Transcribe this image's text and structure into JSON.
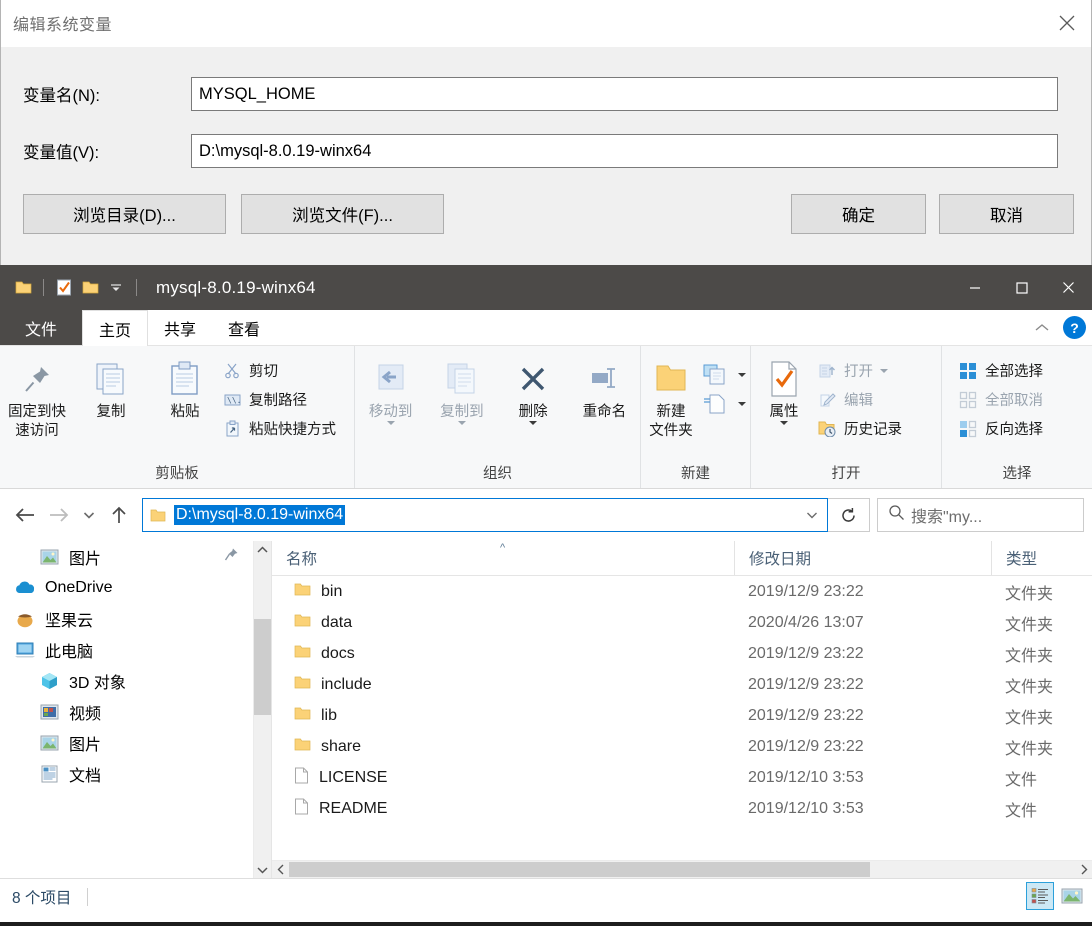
{
  "dialog": {
    "title": "编辑系统变量",
    "close_icon": "close-icon",
    "fields": [
      {
        "label": "变量名(N):",
        "value": "MYSQL_HOME"
      },
      {
        "label": "变量值(V):",
        "value": "D:\\mysql-8.0.19-winx64"
      }
    ],
    "buttons": {
      "browse_dir": "浏览目录(D)...",
      "browse_file": "浏览文件(F)...",
      "ok": "确定",
      "cancel": "取消"
    }
  },
  "explorer": {
    "title": "mysql-8.0.19-winx64",
    "window_controls": {
      "minimize": "—",
      "maximize": "▢",
      "close": "✕"
    },
    "tabs": [
      {
        "label": "文件",
        "kind": "file"
      },
      {
        "label": "主页",
        "kind": "active"
      },
      {
        "label": "共享",
        "kind": "normal"
      },
      {
        "label": "查看",
        "kind": "normal"
      }
    ],
    "help_label": "?",
    "ribbon": {
      "groups": [
        {
          "title": "剪贴板",
          "big": [
            {
              "label": "固定到快\n速访问",
              "line1": "固定到快",
              "line2": "速访问",
              "icon": "pin-icon",
              "dim": false
            },
            {
              "label": "复制",
              "line1": "复制",
              "line2": "",
              "icon": "copy-icon",
              "dim": false
            },
            {
              "label": "粘贴",
              "line1": "粘贴",
              "line2": "",
              "icon": "paste-icon",
              "dim": false
            }
          ],
          "small": [
            {
              "label": "剪切",
              "icon": "scissors-icon",
              "dim": false
            },
            {
              "label": "复制路径",
              "icon": "copy-path-icon",
              "dim": false
            },
            {
              "label": "粘贴快捷方式",
              "icon": "paste-shortcut-icon",
              "dim": false
            }
          ]
        },
        {
          "title": "组织",
          "big": [
            {
              "line1": "移动到",
              "line2": "",
              "icon": "move-to-icon",
              "dim": true,
              "caret": true
            },
            {
              "line1": "复制到",
              "line2": "",
              "icon": "copy-to-icon",
              "dim": true,
              "caret": true
            },
            {
              "line1": "删除",
              "line2": "",
              "icon": "delete-icon",
              "dim": false,
              "caret": true
            },
            {
              "line1": "重命名",
              "line2": "",
              "icon": "rename-icon",
              "dim": false,
              "caret": false
            }
          ],
          "small": []
        },
        {
          "title": "新建",
          "big": [
            {
              "line1": "新建",
              "line2": "文件夹",
              "icon": "new-folder-icon",
              "dim": false,
              "caret": false
            }
          ],
          "small": [
            {
              "label": "",
              "icon": "new-item-icon",
              "dim": false,
              "caret": true
            },
            {
              "label": "",
              "icon": "easy-access-icon",
              "dim": false,
              "caret": true
            }
          ]
        },
        {
          "title": "打开",
          "big": [
            {
              "line1": "属性",
              "line2": "",
              "icon": "properties-icon",
              "dim": false,
              "caret": true
            }
          ],
          "small": [
            {
              "label": "打开",
              "icon": "open-icon",
              "dim": true,
              "caret": true
            },
            {
              "label": "编辑",
              "icon": "edit-icon",
              "dim": true,
              "caret": false
            },
            {
              "label": "历史记录",
              "icon": "history-icon",
              "dim": false,
              "caret": false
            }
          ]
        },
        {
          "title": "选择",
          "big": [],
          "small": [
            {
              "label": "全部选择",
              "icon": "select-all-icon",
              "dim": false
            },
            {
              "label": "全部取消",
              "icon": "select-none-icon",
              "dim": true
            },
            {
              "label": "反向选择",
              "icon": "invert-selection-icon",
              "dim": false
            }
          ]
        }
      ]
    },
    "addressbar": {
      "back_icon": "back-arrow-icon",
      "forward_icon": "forward-arrow-icon",
      "recent_icon": "chevron-down-icon",
      "up_icon": "up-arrow-icon",
      "path": "D:\\mysql-8.0.19-winx64",
      "dropdown_icon": "chevron-down-icon",
      "refresh_icon": "refresh-icon",
      "search_icon": "search-icon",
      "search_placeholder": "搜索\"my..."
    },
    "nav_pane": {
      "items": [
        {
          "label": "图片",
          "icon": "pictures-icon",
          "indent": 1,
          "pinned": true
        },
        {
          "label": "OneDrive",
          "icon": "onedrive-icon",
          "indent": 0,
          "pinned": false
        },
        {
          "label": "坚果云",
          "icon": "nutstore-icon",
          "indent": 0,
          "pinned": false
        },
        {
          "label": "此电脑",
          "icon": "this-pc-icon",
          "indent": 0,
          "pinned": false
        },
        {
          "label": "3D 对象",
          "icon": "3d-objects-icon",
          "indent": 1,
          "pinned": false
        },
        {
          "label": "视频",
          "icon": "videos-icon",
          "indent": 1,
          "pinned": false
        },
        {
          "label": "图片",
          "icon": "pictures-icon",
          "indent": 1,
          "pinned": false
        },
        {
          "label": "文档",
          "icon": "documents-icon",
          "indent": 1,
          "pinned": false
        }
      ]
    },
    "file_list": {
      "columns": [
        "名称",
        "修改日期",
        "类型"
      ],
      "sort_column": "名称",
      "sort_direction": "asc",
      "rows": [
        {
          "name": "bin",
          "date": "2019/12/9 23:22",
          "type": "文件夹",
          "icon": "folder-icon"
        },
        {
          "name": "data",
          "date": "2020/4/26 13:07",
          "type": "文件夹",
          "icon": "folder-icon"
        },
        {
          "name": "docs",
          "date": "2019/12/9 23:22",
          "type": "文件夹",
          "icon": "folder-icon"
        },
        {
          "name": "include",
          "date": "2019/12/9 23:22",
          "type": "文件夹",
          "icon": "folder-icon"
        },
        {
          "name": "lib",
          "date": "2019/12/9 23:22",
          "type": "文件夹",
          "icon": "folder-icon"
        },
        {
          "name": "share",
          "date": "2019/12/9 23:22",
          "type": "文件夹",
          "icon": "folder-icon"
        },
        {
          "name": "LICENSE",
          "date": "2019/12/10 3:53",
          "type": "文件",
          "icon": "file-icon"
        },
        {
          "name": "README",
          "date": "2019/12/10 3:53",
          "type": "文件",
          "icon": "file-icon"
        }
      ]
    },
    "statusbar": {
      "item_count": "8 个项目",
      "view_details_icon": "details-view-icon",
      "view_thumbnails_icon": "thumbnails-view-icon",
      "active_view": "details"
    }
  },
  "colors": {
    "accent": "#0078d7",
    "titlebar": "#4c4a48",
    "folder_yellow": "#fbd277",
    "selection": "#0078d7",
    "help_blue": "#0078d7",
    "check_orange": "#e8690b"
  }
}
